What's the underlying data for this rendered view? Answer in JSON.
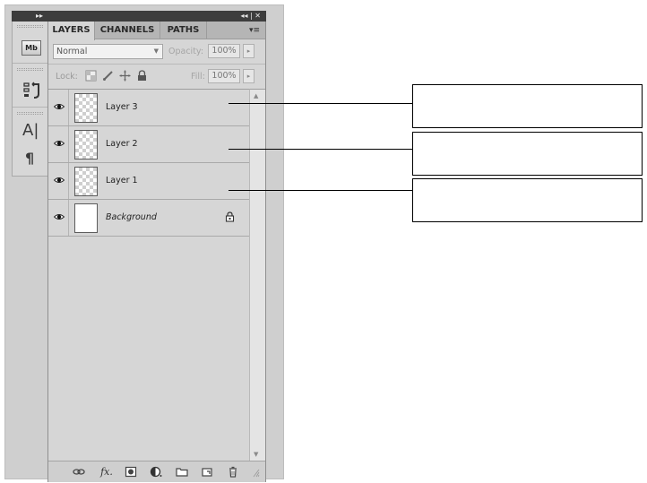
{
  "panel": {
    "tabs": [
      {
        "label": "LAYERS",
        "active": true
      },
      {
        "label": "CHANNELS",
        "active": false
      },
      {
        "label": "PATHS",
        "active": false
      }
    ],
    "blend_mode": "Normal",
    "opacity_label": "Opacity:",
    "opacity_value": "100%",
    "lock_label": "Lock:",
    "fill_label": "Fill:",
    "fill_value": "100%"
  },
  "dock": {
    "icons": [
      "mini-bridge-icon",
      "history-icon",
      "character-icon",
      "paragraph-icon"
    ],
    "mb_text": "Mb",
    "char_text": "A|",
    "para_text": "¶"
  },
  "layers": [
    {
      "name": "Layer 3",
      "visible": true,
      "transparent": true,
      "italic": false
    },
    {
      "name": "Layer 2",
      "visible": true,
      "transparent": true,
      "italic": false
    },
    {
      "name": "Layer 1",
      "visible": true,
      "transparent": true,
      "italic": false
    },
    {
      "name": "Background",
      "visible": true,
      "transparent": false,
      "italic": true,
      "locked": true
    }
  ],
  "bottom_bar": [
    "link-icon",
    "fx-icon",
    "mask-icon",
    "adjustment-icon",
    "folder-icon",
    "new-layer-icon",
    "trash-icon"
  ],
  "bottom_bar_fx_text": "fx."
}
